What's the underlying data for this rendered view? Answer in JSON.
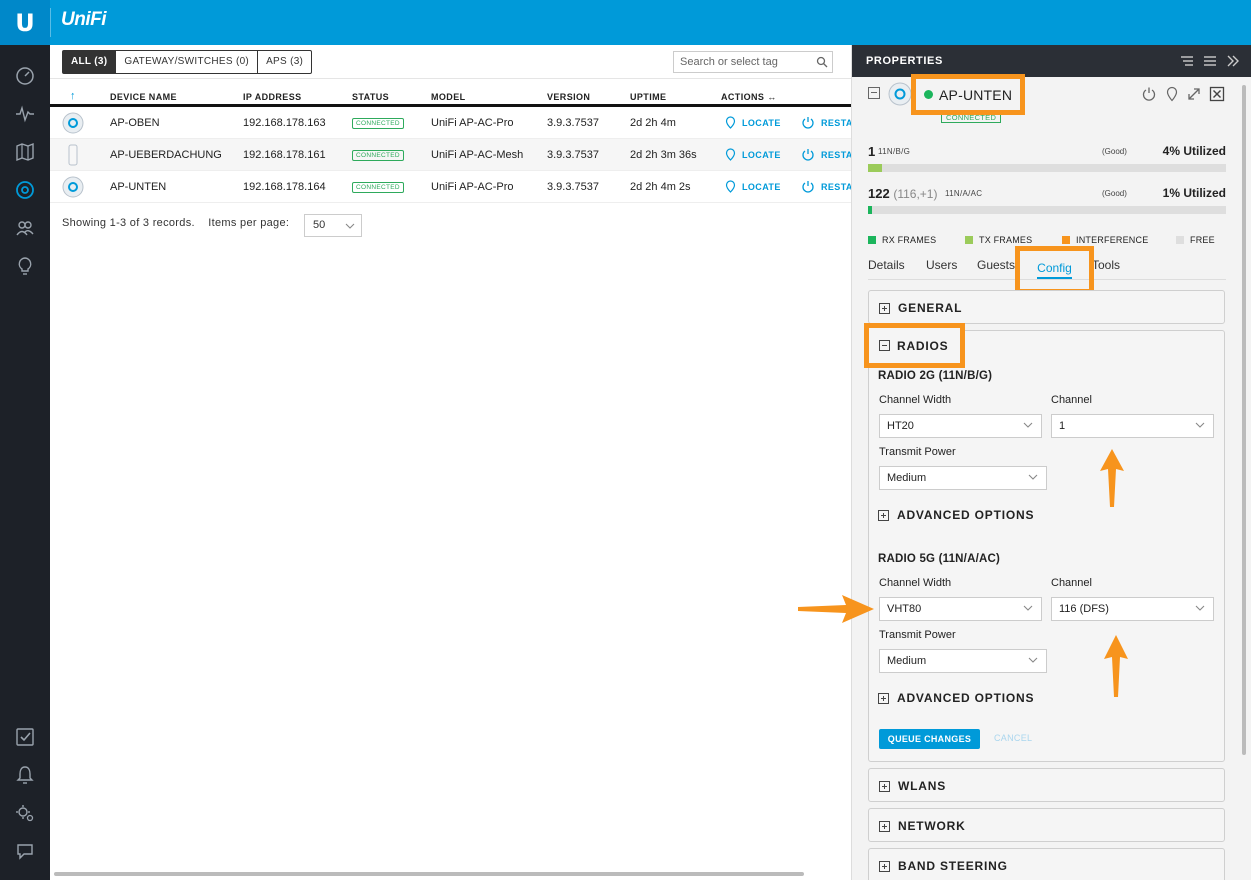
{
  "app": {
    "logo_letter": "U",
    "brand": "UniFi"
  },
  "nav": [
    "dashboard-icon",
    "statistics-icon",
    "map-icon",
    "devices-icon",
    "clients-icon",
    "insights-icon",
    "events-icon",
    "alerts-icon",
    "settings-icon",
    "chat-icon"
  ],
  "filters": {
    "all": "ALL (3)",
    "gateway": "GATEWAY/SWITCHES (0)",
    "aps": "APS (3)"
  },
  "search": {
    "placeholder": "Search or select tag"
  },
  "table": {
    "sort_indicator": "↑",
    "headers": {
      "name": "DEVICE NAME",
      "ip": "IP ADDRESS",
      "status": "STATUS",
      "model": "MODEL",
      "version": "VERSION",
      "uptime": "UPTIME",
      "actions": "ACTIONS ↔"
    },
    "rows": [
      {
        "name": "AP-OBEN",
        "ip": "192.168.178.163",
        "status": "CONNECTED",
        "model": "UniFi AP-AC-Pro",
        "version": "3.9.3.7537",
        "uptime": "2d 2h 4m",
        "locate": "LOCATE",
        "restart": "RESTA"
      },
      {
        "name": "AP-UEBERDACHUNG",
        "ip": "192.168.178.161",
        "status": "CONNECTED",
        "model": "UniFi AP-AC-Mesh",
        "version": "3.9.3.7537",
        "uptime": "2d 2h 3m 36s",
        "locate": "LOCATE",
        "restart": "RESTA"
      },
      {
        "name": "AP-UNTEN",
        "ip": "192.168.178.164",
        "status": "CONNECTED",
        "model": "UniFi AP-AC-Pro",
        "version": "3.9.3.7537",
        "uptime": "2d 2h 4m 2s",
        "locate": "LOCATE",
        "restart": "RESTA"
      }
    ]
  },
  "paging": {
    "summary": "Showing 1-3 of 3 records.",
    "items_label": "Items per page:",
    "per_page": "50"
  },
  "properties": {
    "title": "PROPERTIES",
    "device_name": "AP-UNTEN",
    "device_status": "CONNECTED",
    "util_24": {
      "channel": "1",
      "channel_sub": "",
      "band": "11N/B/G",
      "quality": "(Good)",
      "utilized": "4% Utilized",
      "fill": 0.04
    },
    "util_5": {
      "channel": "122",
      "channel_sub": "(116,+1)",
      "band": "11N/A/AC",
      "quality": "(Good)",
      "utilized": "1% Utilized",
      "fill": 0.01
    },
    "legend": {
      "rx": "RX FRAMES",
      "tx": "TX FRAMES",
      "interference": "INTERFERENCE",
      "free": "FREE"
    },
    "tabs": {
      "details": "Details",
      "users": "Users",
      "guests": "Guests",
      "config": "Config",
      "tools": "Tools"
    },
    "sections": {
      "general": "GENERAL",
      "radios": "RADIOS",
      "wlans": "WLANS",
      "network": "NETWORK",
      "band_steering": "BAND STEERING"
    },
    "radio_2g": {
      "heading": "RADIO 2G (11N/B/G)",
      "width_label": "Channel Width",
      "width": "HT20",
      "channel_label": "Channel",
      "channel": "1",
      "power_label": "Transmit Power",
      "power": "Medium",
      "advanced": "ADVANCED OPTIONS"
    },
    "radio_5g": {
      "heading": "RADIO 5G (11N/A/AC)",
      "width_label": "Channel Width",
      "width": "VHT80",
      "channel_label": "Channel",
      "channel": "116 (DFS)",
      "power_label": "Transmit Power",
      "power": "Medium",
      "advanced": "ADVANCED OPTIONS"
    },
    "queue": "QUEUE CHANGES",
    "cancel": "CANCEL"
  },
  "colors": {
    "brand": "#009ad9",
    "highlight": "#f7941d",
    "connected": "#1bb55c"
  }
}
